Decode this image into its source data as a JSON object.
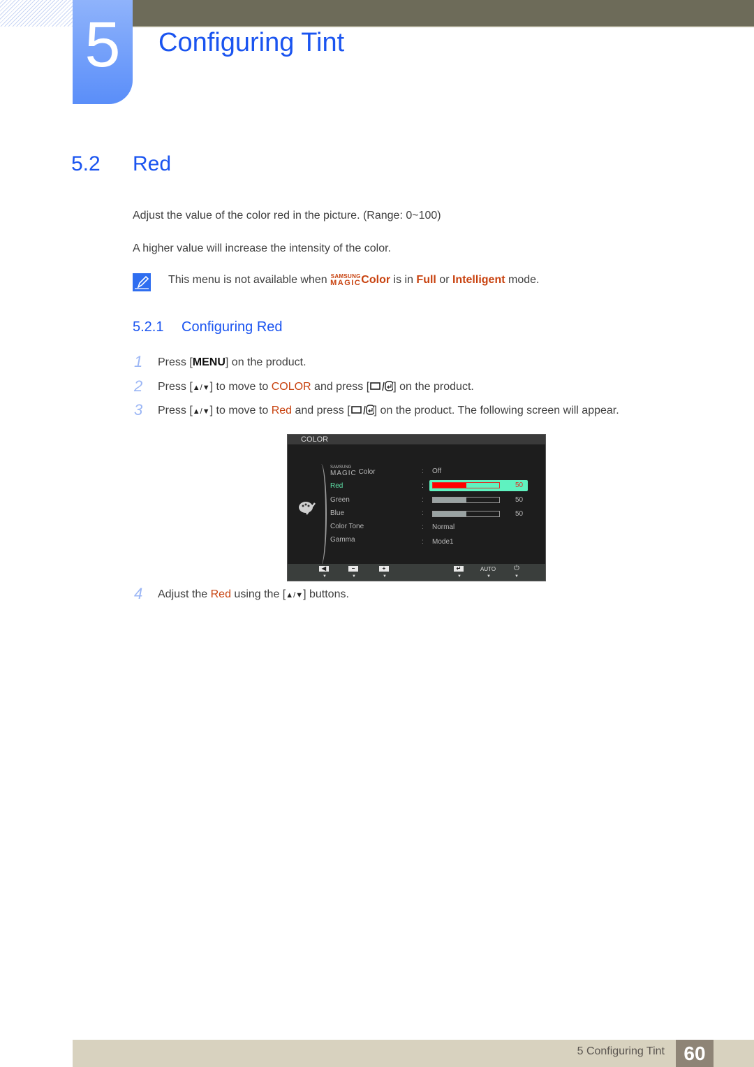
{
  "chapter": {
    "number": "5",
    "title": "Configuring Tint"
  },
  "section": {
    "number": "5.2",
    "title": "Red"
  },
  "paragraphs": [
    "Adjust the value of the color red in the picture. (Range: 0~100)",
    "A higher value will increase the intensity of the color."
  ],
  "note": {
    "icon": "note-pencil-icon",
    "prefix": "This menu is not available when ",
    "magic_small": "SAMSUNG",
    "magic_big": "MAGIC",
    "color_word": "Color",
    "mid1": " is in ",
    "full": "Full",
    "mid2": " or ",
    "intelligent": "Intelligent",
    "suffix": " mode."
  },
  "subsection": {
    "number": "5.2.1",
    "title": "Configuring Red"
  },
  "steps": [
    {
      "num": "1",
      "a": "Press [",
      "key": "MENU",
      "b": "] on the product."
    },
    {
      "num": "2",
      "a": "Press [",
      "arrows": "▲/▼",
      "b": "] to move to ",
      "hl": "COLOR",
      "c": " and press [",
      "d": "] on the product."
    },
    {
      "num": "3",
      "a": "Press [",
      "arrows": "▲/▼",
      "b": "] to move to ",
      "hl": "Red",
      "c": " and press [",
      "d": "] on the product. The following screen will appear."
    },
    {
      "num": "4",
      "a": "Adjust the ",
      "hl": "Red",
      "b": " using the [",
      "arrows": "▲/▼",
      "c": "] buttons."
    }
  ],
  "osd": {
    "header": "COLOR",
    "magic_small": "SAMSUNG",
    "magic_big": "MAGIC",
    "items": [
      {
        "label": "Color",
        "value": "Off"
      },
      {
        "label": "Red",
        "value": "50",
        "level": 0.5,
        "selected": true
      },
      {
        "label": "Green",
        "value": "50",
        "level": 0.5
      },
      {
        "label": "Blue",
        "value": "50",
        "level": 0.5
      },
      {
        "label": "Color Tone",
        "value": "Normal"
      },
      {
        "label": "Gamma",
        "value": "Mode1"
      }
    ],
    "footer": {
      "auto": "AUTO"
    }
  },
  "footer": {
    "text": "5 Configuring Tint",
    "page": "60"
  },
  "colors": {
    "accent_blue": "#1a54f0",
    "highlight": "#c8420f",
    "osd_select": "#5ff2c0"
  }
}
